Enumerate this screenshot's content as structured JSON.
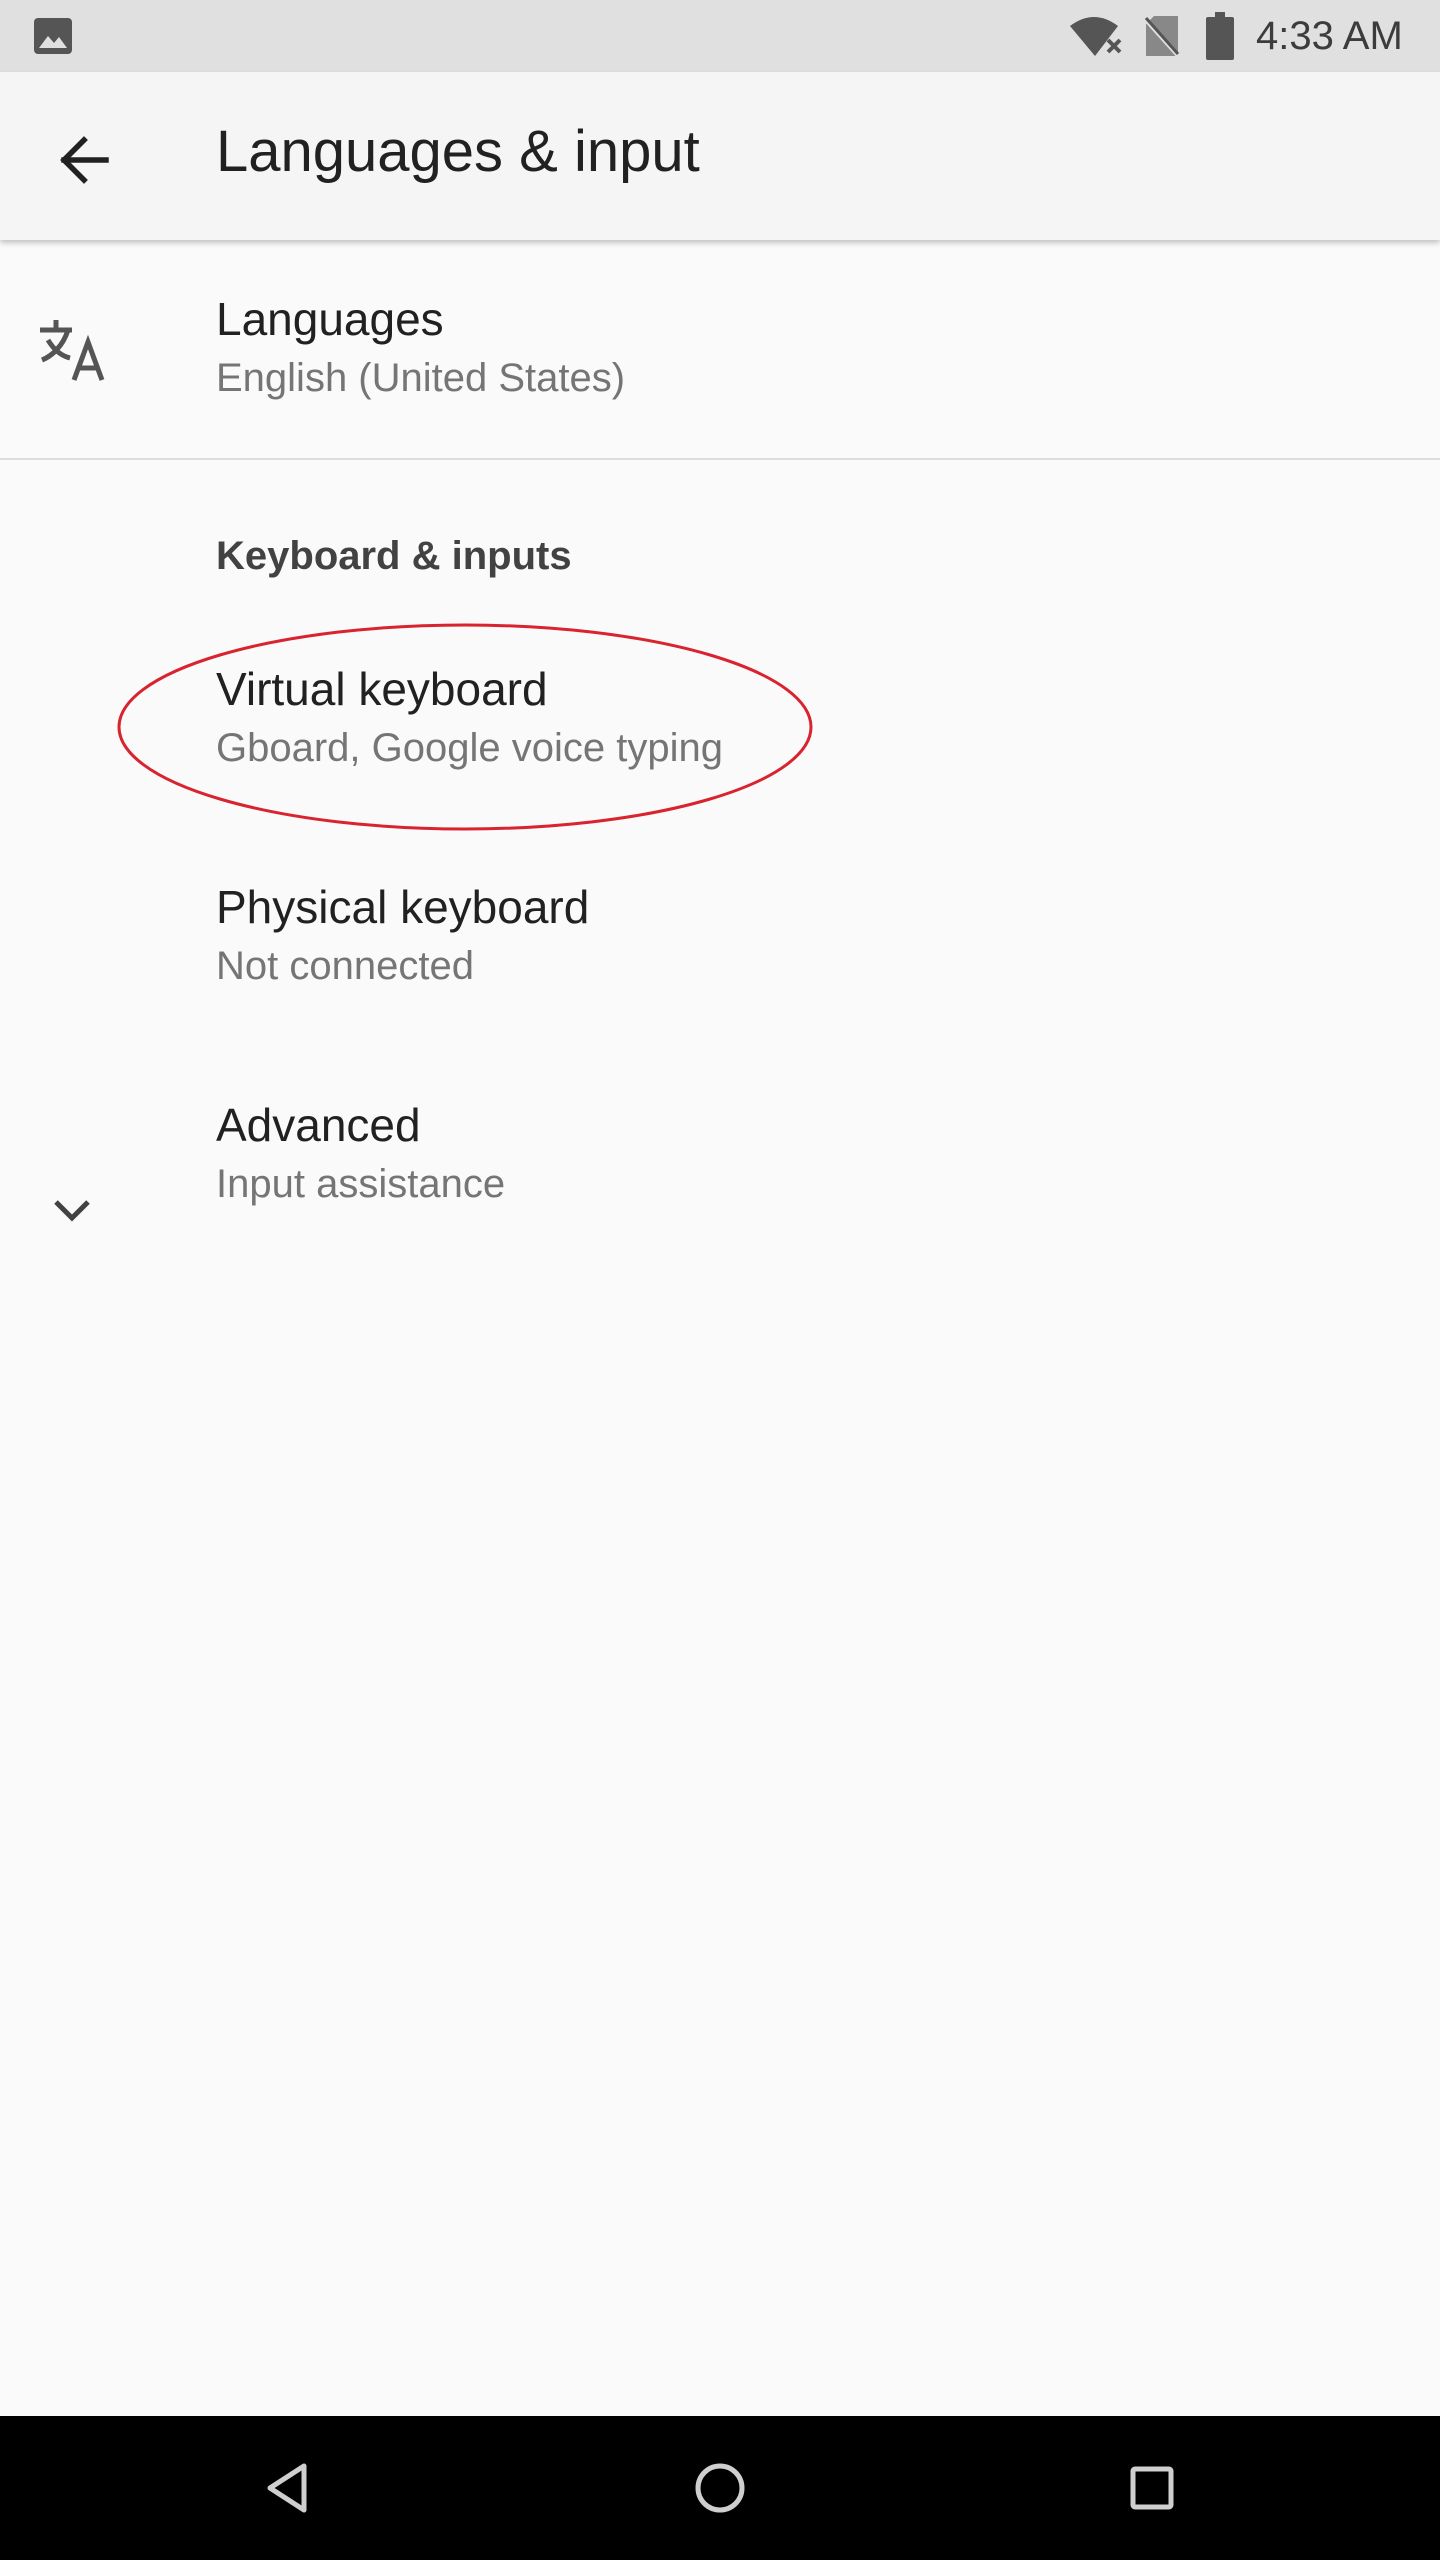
{
  "status_bar": {
    "time": "4:33 AM",
    "icons": [
      "image-notification-icon",
      "wifi-off-icon",
      "no-sim-icon",
      "battery-icon"
    ]
  },
  "app_bar": {
    "title": "Languages & input",
    "back_icon": "arrow-back-icon"
  },
  "languages": {
    "title": "Languages",
    "summary": "English (United States)",
    "icon": "translate-icon"
  },
  "keyboard_section": {
    "header": "Keyboard & inputs",
    "items": [
      {
        "title": "Virtual keyboard",
        "summary": "Gboard, Google voice typing"
      },
      {
        "title": "Physical keyboard",
        "summary": "Not connected"
      }
    ]
  },
  "advanced": {
    "title": "Advanced",
    "summary": "Input assistance",
    "icon": "chevron-down-icon"
  },
  "annotation": {
    "shape": "ellipse",
    "color": "#d9232e",
    "target": "Virtual keyboard"
  },
  "nav_bar": {
    "buttons": [
      "back-triangle-icon",
      "home-circle-icon",
      "recents-square-icon"
    ]
  },
  "colors": {
    "status_bar_bg": "#e0e0e0",
    "app_bar_bg": "#f5f5f5",
    "page_bg": "#fafafa",
    "primary_text": "#212121",
    "secondary_text": "#757575",
    "nav_bar_bg": "#000000"
  }
}
